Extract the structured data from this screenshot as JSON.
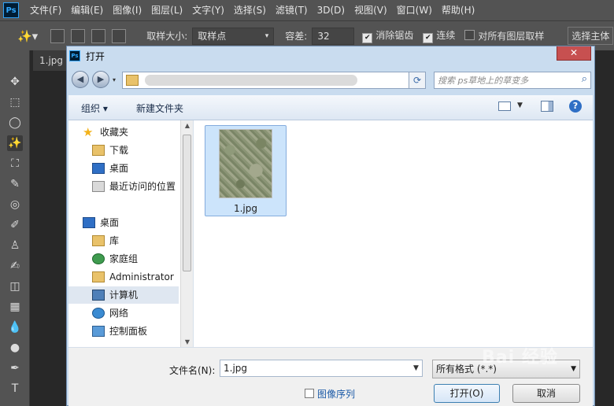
{
  "ps": {
    "logo": "Ps",
    "menu": [
      "文件(F)",
      "编辑(E)",
      "图像(I)",
      "图层(L)",
      "文字(Y)",
      "选择(S)",
      "滤镜(T)",
      "3D(D)",
      "视图(V)",
      "窗口(W)",
      "帮助(H)"
    ],
    "options": {
      "sample_size_label": "取样大小:",
      "sample_size_value": "取样点",
      "tolerance_label": "容差:",
      "tolerance_value": "32",
      "antialias_label": "消除锯齿",
      "antialias_checked": true,
      "contiguous_label": "连续",
      "contiguous_checked": true,
      "all_layers_label": "对所有图层取样",
      "all_layers_checked": false,
      "select_subject_label": "选择主体"
    },
    "doc_tab": "1.jpg",
    "tools": [
      "move-tool",
      "marquee-tool",
      "lasso-tool",
      "magic-wand-tool",
      "crop-tool",
      "eyedropper-tool",
      "healing-tool",
      "brush-tool",
      "stamp-tool",
      "history-brush-tool",
      "eraser-tool",
      "gradient-tool",
      "blur-tool",
      "dodge-tool",
      "pen-tool",
      "type-tool"
    ],
    "tool_glyphs": [
      "✥",
      "⬚",
      "◯",
      "✨",
      "⛶",
      "✎",
      "◎",
      "✐",
      "♙",
      "✍",
      "◫",
      "▦",
      "💧",
      "●",
      "✒",
      "T"
    ],
    "active_tool": "magic-wand-tool"
  },
  "dialog": {
    "title": "打开",
    "close_label": "✕",
    "search_placeholder": "搜索 ps草地上的草变多",
    "toolbar": {
      "organize_label": "组织 ▾",
      "new_folder_label": "新建文件夹",
      "help_label": "?"
    },
    "nav": {
      "favorites_label": "收藏夹",
      "downloads_label": "下载",
      "desktop_fav_label": "桌面",
      "recent_label": "最近访问的位置",
      "desktop_label": "桌面",
      "library_label": "库",
      "homegroup_label": "家庭组",
      "administrator_label": "Administrator",
      "computer_label": "计算机",
      "network_label": "网络",
      "control_panel_label": "控制面板"
    },
    "files": [
      {
        "name": "1.jpg"
      }
    ],
    "filename_label": "文件名(N):",
    "filename_value": "1.jpg",
    "filetype_value": "所有格式 (*.*)",
    "sequence_label": "图像序列",
    "open_label": "打开(O)",
    "cancel_label": "取消"
  },
  "watermark": "Bai 经验"
}
